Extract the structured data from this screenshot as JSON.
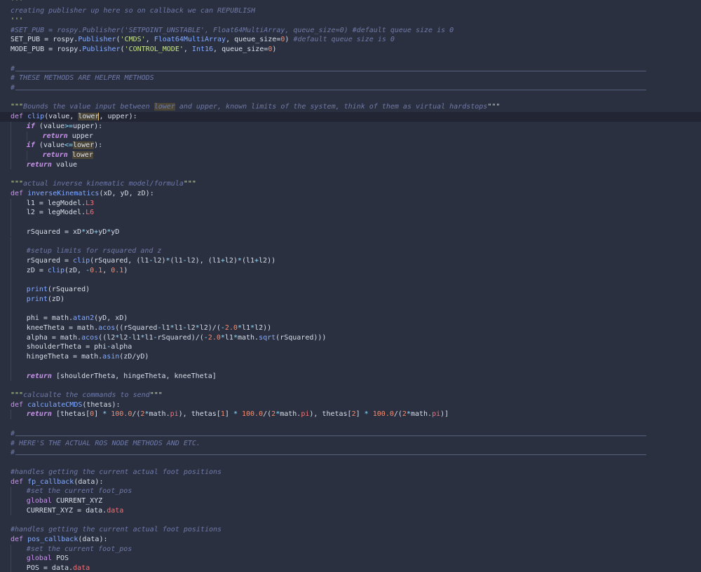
{
  "colors": {
    "background": "#2b3040",
    "active_line": "#222634",
    "comment": "#6f7aa8",
    "string": "#c6e38d",
    "keyword": "#c792ea",
    "function": "#82aaff",
    "number": "#f78c6c",
    "operator": "#89ddff",
    "property": "#f07178",
    "text": "#d8dee9"
  },
  "editor": {
    "active_line": 12,
    "lines": [
      {
        "indent": 0,
        "tokens": [
          [
            "str",
            "'''"
          ]
        ]
      },
      {
        "indent": 0,
        "tokens": [
          [
            "com",
            "creating publisher up here so on callback we can REPUBLISH"
          ]
        ]
      },
      {
        "indent": 0,
        "tokens": [
          [
            "str",
            "'''"
          ]
        ]
      },
      {
        "indent": 0,
        "tokens": [
          [
            "com",
            "#SET_PUB = rospy.Publisher('SETPOINT_UNSTABLE', Float64MultiArray, queue_size=0) #default queue size is 0"
          ]
        ]
      },
      {
        "indent": 0,
        "tokens": [
          [
            "txt",
            "SET_PUB = rospy."
          ],
          [
            "fn",
            "Publisher"
          ],
          [
            "txt",
            "("
          ],
          [
            "str",
            "'CMDS'"
          ],
          [
            "txt",
            ", "
          ],
          [
            "fn",
            "Float64MultiArray"
          ],
          [
            "txt",
            ", queue_size="
          ],
          [
            "num",
            "0"
          ],
          [
            "txt",
            ") "
          ],
          [
            "com",
            "#default queue size is 0"
          ]
        ]
      },
      {
        "indent": 0,
        "tokens": [
          [
            "txt",
            "MODE_PUB = rospy."
          ],
          [
            "fn",
            "Publisher"
          ],
          [
            "txt",
            "("
          ],
          [
            "str",
            "'CONTROL_MODE'"
          ],
          [
            "txt",
            ", "
          ],
          [
            "fn",
            "Int16"
          ],
          [
            "txt",
            ", queue_size="
          ],
          [
            "num",
            "0"
          ],
          [
            "txt",
            ")"
          ]
        ]
      },
      {
        "indent": 0,
        "tokens": []
      },
      {
        "indent": 0,
        "rule": true,
        "tokens": [
          [
            "com",
            "#"
          ]
        ]
      },
      {
        "indent": 0,
        "tokens": [
          [
            "com",
            "# THESE METHODS ARE HELPER METHODS"
          ]
        ]
      },
      {
        "indent": 0,
        "rule": true,
        "tokens": [
          [
            "com",
            "#"
          ]
        ]
      },
      {
        "indent": 0,
        "tokens": []
      },
      {
        "indent": 0,
        "tokens": [
          [
            "str",
            "\"\"\""
          ],
          [
            "com",
            "Bounds the value input between "
          ],
          [
            "comhl",
            "lower"
          ],
          [
            "com",
            " and upper, known limits of the system, think of them as virtual hardstops"
          ],
          [
            "str",
            "\"\"\""
          ]
        ]
      },
      {
        "indent": 0,
        "tokens": [
          [
            "kw",
            "def "
          ],
          [
            "fn",
            "clip"
          ],
          [
            "txt",
            "(value, "
          ],
          [
            "hl",
            "lower"
          ],
          [
            "cursor",
            ""
          ],
          [
            "txt",
            ", upper"
          ],
          [
            "txt",
            "):"
          ]
        ]
      },
      {
        "indent": 1,
        "tokens": [
          [
            "kwi",
            "if "
          ],
          [
            "txt",
            "(value"
          ],
          [
            "op",
            ">="
          ],
          [
            "txt",
            "upper):"
          ]
        ]
      },
      {
        "indent": 2,
        "tokens": [
          [
            "kwi",
            "return "
          ],
          [
            "txt",
            "upper"
          ]
        ]
      },
      {
        "indent": 1,
        "tokens": [
          [
            "kwi",
            "if "
          ],
          [
            "txt",
            "(value"
          ],
          [
            "op",
            "<="
          ],
          [
            "hl",
            "lower"
          ],
          [
            "txt",
            "):"
          ]
        ]
      },
      {
        "indent": 2,
        "tokens": [
          [
            "kwi",
            "return "
          ],
          [
            "hl",
            "lower"
          ]
        ]
      },
      {
        "indent": 1,
        "tokens": [
          [
            "kwi",
            "return "
          ],
          [
            "txt",
            "value"
          ]
        ]
      },
      {
        "indent": 0,
        "tokens": []
      },
      {
        "indent": 0,
        "tokens": [
          [
            "str",
            "\"\"\""
          ],
          [
            "com",
            "actual inverse kinematic model/formula"
          ],
          [
            "str",
            "\"\"\""
          ]
        ]
      },
      {
        "indent": 0,
        "tokens": [
          [
            "kw",
            "def "
          ],
          [
            "fn",
            "inverseKinematics"
          ],
          [
            "txt",
            "(xD, yD, zD):"
          ]
        ]
      },
      {
        "indent": 1,
        "tokens": [
          [
            "txt",
            "l1 = legModel."
          ],
          [
            "attr",
            "L3"
          ]
        ]
      },
      {
        "indent": 1,
        "tokens": [
          [
            "txt",
            "l2 = legModel."
          ],
          [
            "attr",
            "L6"
          ]
        ]
      },
      {
        "indent": 1,
        "tokens": []
      },
      {
        "indent": 1,
        "tokens": [
          [
            "txt",
            "rSquared = xD"
          ],
          [
            "op",
            "*"
          ],
          [
            "txt",
            "xD"
          ],
          [
            "op",
            "+"
          ],
          [
            "txt",
            "yD"
          ],
          [
            "op",
            "*"
          ],
          [
            "txt",
            "yD"
          ]
        ]
      },
      {
        "indent": 1,
        "tokens": []
      },
      {
        "indent": 1,
        "tokens": [
          [
            "com",
            "#setup limits for rsquared and z"
          ]
        ]
      },
      {
        "indent": 1,
        "tokens": [
          [
            "txt",
            "rSquared = "
          ],
          [
            "fn",
            "clip"
          ],
          [
            "txt",
            "(rSquared, (l1"
          ],
          [
            "op",
            "-"
          ],
          [
            "txt",
            "l2)"
          ],
          [
            "op",
            "*"
          ],
          [
            "txt",
            "(l1"
          ],
          [
            "op",
            "-"
          ],
          [
            "txt",
            "l2), (l1"
          ],
          [
            "op",
            "+"
          ],
          [
            "txt",
            "l2)"
          ],
          [
            "op",
            "*"
          ],
          [
            "txt",
            "(l1"
          ],
          [
            "op",
            "+"
          ],
          [
            "txt",
            "l2))"
          ]
        ]
      },
      {
        "indent": 1,
        "tokens": [
          [
            "txt",
            "zD = "
          ],
          [
            "fn",
            "clip"
          ],
          [
            "txt",
            "(zD, "
          ],
          [
            "op",
            "-"
          ],
          [
            "num",
            "0.1"
          ],
          [
            "txt",
            ", "
          ],
          [
            "num",
            "0.1"
          ],
          [
            "txt",
            ")"
          ]
        ]
      },
      {
        "indent": 1,
        "tokens": []
      },
      {
        "indent": 1,
        "tokens": [
          [
            "fn",
            "print"
          ],
          [
            "txt",
            "(rSquared)"
          ]
        ]
      },
      {
        "indent": 1,
        "tokens": [
          [
            "fn",
            "print"
          ],
          [
            "txt",
            "(zD)"
          ]
        ]
      },
      {
        "indent": 1,
        "tokens": []
      },
      {
        "indent": 1,
        "tokens": [
          [
            "txt",
            "phi = math."
          ],
          [
            "fn",
            "atan2"
          ],
          [
            "txt",
            "(yD, xD)"
          ]
        ]
      },
      {
        "indent": 1,
        "tokens": [
          [
            "txt",
            "kneeTheta = math."
          ],
          [
            "fn",
            "acos"
          ],
          [
            "txt",
            "((rSquared"
          ],
          [
            "op",
            "-"
          ],
          [
            "txt",
            "l1"
          ],
          [
            "op",
            "*"
          ],
          [
            "txt",
            "l1"
          ],
          [
            "op",
            "-"
          ],
          [
            "txt",
            "l2"
          ],
          [
            "op",
            "*"
          ],
          [
            "txt",
            "l2)/("
          ],
          [
            "op",
            "-"
          ],
          [
            "num",
            "2.0"
          ],
          [
            "op",
            "*"
          ],
          [
            "txt",
            "l1"
          ],
          [
            "op",
            "*"
          ],
          [
            "txt",
            "l2))"
          ]
        ]
      },
      {
        "indent": 1,
        "tokens": [
          [
            "txt",
            "alpha = math."
          ],
          [
            "fn",
            "acos"
          ],
          [
            "txt",
            "((l2"
          ],
          [
            "op",
            "*"
          ],
          [
            "txt",
            "l2"
          ],
          [
            "op",
            "-"
          ],
          [
            "txt",
            "l1"
          ],
          [
            "op",
            "*"
          ],
          [
            "txt",
            "l1"
          ],
          [
            "op",
            "-"
          ],
          [
            "txt",
            "rSquared)/("
          ],
          [
            "op",
            "-"
          ],
          [
            "num",
            "2.0"
          ],
          [
            "op",
            "*"
          ],
          [
            "txt",
            "l1"
          ],
          [
            "op",
            "*"
          ],
          [
            "txt",
            "math."
          ],
          [
            "fn",
            "sqrt"
          ],
          [
            "txt",
            "(rSquared)))"
          ]
        ]
      },
      {
        "indent": 1,
        "tokens": [
          [
            "txt",
            "shoulderTheta = phi"
          ],
          [
            "op",
            "-"
          ],
          [
            "txt",
            "alpha"
          ]
        ]
      },
      {
        "indent": 1,
        "tokens": [
          [
            "txt",
            "hingeTheta = math."
          ],
          [
            "fn",
            "asin"
          ],
          [
            "txt",
            "(zD/yD)"
          ]
        ]
      },
      {
        "indent": 1,
        "tokens": []
      },
      {
        "indent": 1,
        "tokens": [
          [
            "kwi",
            "return "
          ],
          [
            "txt",
            "[shoulderTheta, hingeTheta, kneeTheta]"
          ]
        ]
      },
      {
        "indent": 0,
        "tokens": []
      },
      {
        "indent": 0,
        "tokens": [
          [
            "str",
            "\"\"\""
          ],
          [
            "com",
            "calcualte the commands to send"
          ],
          [
            "str",
            "\"\"\""
          ]
        ]
      },
      {
        "indent": 0,
        "tokens": [
          [
            "kw",
            "def "
          ],
          [
            "fn",
            "calculateCMDS"
          ],
          [
            "txt",
            "(thetas):"
          ]
        ]
      },
      {
        "indent": 1,
        "tokens": [
          [
            "kwi",
            "return "
          ],
          [
            "txt",
            "[thetas["
          ],
          [
            "num",
            "0"
          ],
          [
            "txt",
            "] "
          ],
          [
            "op",
            "*"
          ],
          [
            "txt",
            " "
          ],
          [
            "num",
            "100.0"
          ],
          [
            "txt",
            "/("
          ],
          [
            "num",
            "2"
          ],
          [
            "op",
            "*"
          ],
          [
            "txt",
            "math."
          ],
          [
            "attr",
            "pi"
          ],
          [
            "txt",
            "), thetas["
          ],
          [
            "num",
            "1"
          ],
          [
            "txt",
            "] "
          ],
          [
            "op",
            "*"
          ],
          [
            "txt",
            " "
          ],
          [
            "num",
            "100.0"
          ],
          [
            "txt",
            "/("
          ],
          [
            "num",
            "2"
          ],
          [
            "op",
            "*"
          ],
          [
            "txt",
            "math."
          ],
          [
            "attr",
            "pi"
          ],
          [
            "txt",
            "), thetas["
          ],
          [
            "num",
            "2"
          ],
          [
            "txt",
            "] "
          ],
          [
            "op",
            "*"
          ],
          [
            "txt",
            " "
          ],
          [
            "num",
            "100.0"
          ],
          [
            "txt",
            "/("
          ],
          [
            "num",
            "2"
          ],
          [
            "op",
            "*"
          ],
          [
            "txt",
            "math."
          ],
          [
            "attr",
            "pi"
          ],
          [
            "txt",
            ")]"
          ]
        ]
      },
      {
        "indent": 0,
        "tokens": []
      },
      {
        "indent": 0,
        "rule": true,
        "tokens": [
          [
            "com",
            "#"
          ]
        ]
      },
      {
        "indent": 0,
        "tokens": [
          [
            "com",
            "# HERE'S THE ACTUAL ROS NODE METHODS AND ETC."
          ]
        ]
      },
      {
        "indent": 0,
        "rule": true,
        "tokens": [
          [
            "com",
            "#"
          ]
        ]
      },
      {
        "indent": 0,
        "tokens": []
      },
      {
        "indent": 0,
        "tokens": [
          [
            "com",
            "#handles getting the current actual foot positions"
          ]
        ]
      },
      {
        "indent": 0,
        "tokens": [
          [
            "kw",
            "def "
          ],
          [
            "fn",
            "fp_callback"
          ],
          [
            "txt",
            "(data):"
          ]
        ]
      },
      {
        "indent": 1,
        "tokens": [
          [
            "com",
            "#set the current foot_pos"
          ]
        ]
      },
      {
        "indent": 1,
        "tokens": [
          [
            "kw",
            "global "
          ],
          [
            "txt",
            "CURRENT_XYZ"
          ]
        ]
      },
      {
        "indent": 1,
        "tokens": [
          [
            "txt",
            "CURRENT_XYZ = data."
          ],
          [
            "attr",
            "data"
          ]
        ]
      },
      {
        "indent": 0,
        "tokens": []
      },
      {
        "indent": 0,
        "tokens": [
          [
            "com",
            "#handles getting the current actual foot positions"
          ]
        ]
      },
      {
        "indent": 0,
        "tokens": [
          [
            "kw",
            "def "
          ],
          [
            "fn",
            "pos_callback"
          ],
          [
            "txt",
            "(data):"
          ]
        ]
      },
      {
        "indent": 1,
        "tokens": [
          [
            "com",
            "#set the current foot_pos"
          ]
        ]
      },
      {
        "indent": 1,
        "tokens": [
          [
            "kw",
            "global "
          ],
          [
            "txt",
            "POS"
          ]
        ]
      },
      {
        "indent": 1,
        "tokens": [
          [
            "txt",
            "POS = data."
          ],
          [
            "attr",
            "data"
          ]
        ]
      }
    ]
  }
}
